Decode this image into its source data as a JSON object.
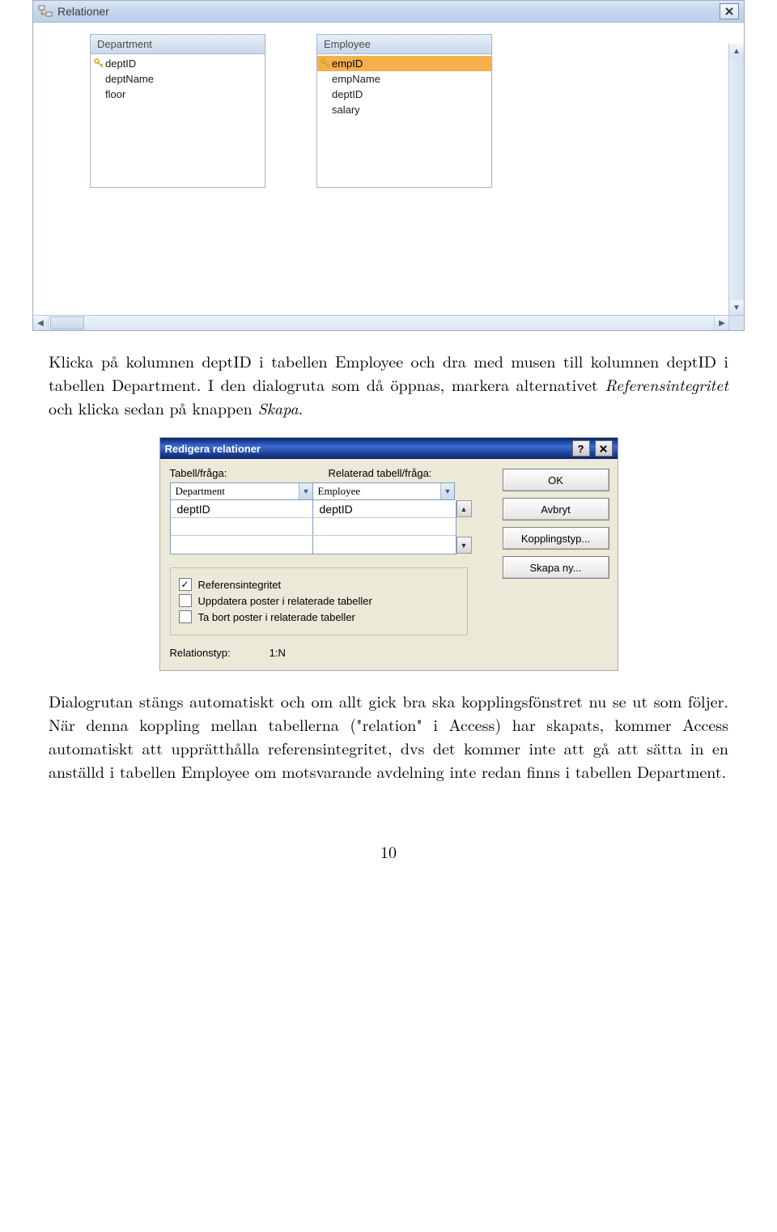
{
  "relations_window": {
    "title": "Relationer",
    "tables": [
      {
        "name": "Department",
        "fields": [
          {
            "label": "deptID",
            "isKey": true,
            "selected": false
          },
          {
            "label": "deptName",
            "isKey": false,
            "selected": false
          },
          {
            "label": "floor",
            "isKey": false,
            "selected": false
          }
        ]
      },
      {
        "name": "Employee",
        "fields": [
          {
            "label": "empID",
            "isKey": true,
            "selected": true
          },
          {
            "label": "empName",
            "isKey": false,
            "selected": false
          },
          {
            "label": "deptID",
            "isKey": false,
            "selected": false
          },
          {
            "label": "salary",
            "isKey": false,
            "selected": false
          }
        ]
      }
    ]
  },
  "paragraph1": {
    "text": "Klicka på kolumnen deptID i tabellen Employee och dra med musen till kolumnen deptID i tabellen Department. I den dialogruta som då öppnas, markera alternativet ",
    "ital1": "Referensintegritet",
    "mid": " och klicka sedan på knappen ",
    "ital2": "Skapa",
    "end": "."
  },
  "edit_dialog": {
    "title": "Redigera relationer",
    "label_left": "Tabell/fråga:",
    "label_right": "Relaterad tabell/fråga:",
    "table_left": "Department",
    "table_right": "Employee",
    "map_left": "deptID",
    "map_right": "deptID",
    "chk1": {
      "label": "Referensintegritet",
      "checked": true
    },
    "chk2": {
      "label": "Uppdatera poster i relaterade tabeller",
      "checked": false
    },
    "chk3": {
      "label": "Ta bort poster i relaterade tabeller",
      "checked": false
    },
    "reltype_label": "Relationstyp:",
    "reltype_value": "1:N",
    "btn_ok": "OK",
    "btn_cancel": "Avbryt",
    "btn_jointype": "Kopplingstyp...",
    "btn_new": "Skapa ny..."
  },
  "paragraph2": "Dialogrutan stängs automatiskt och om allt gick bra ska kopplingsfönstret nu se ut som följer. När denna koppling mellan tabellerna (\"relation\" i Access) har skapats, kommer Access automatiskt att upprätthålla referensintegritet, dvs det kommer inte att gå att sätta in en anställd i tabellen Employee om motsvarande avdelning inte redan finns i tabellen Department.",
  "page_number": "10"
}
